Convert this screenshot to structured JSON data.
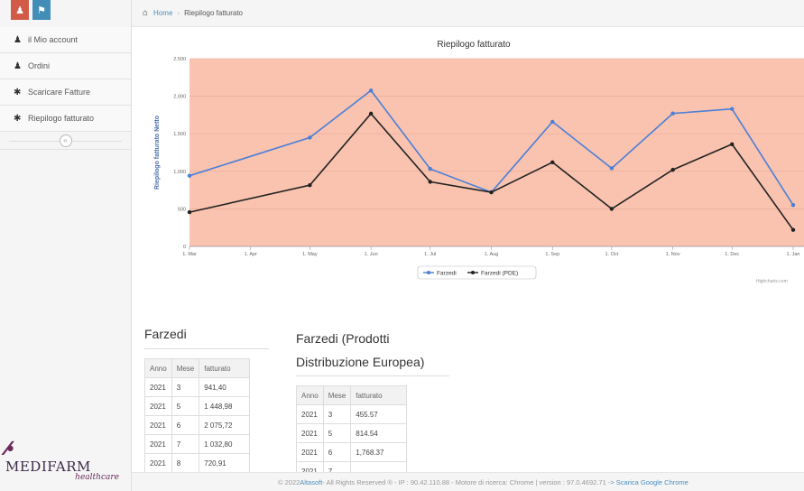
{
  "sidebar": {
    "items": [
      {
        "icon": "user-icon",
        "label": "il Mio account"
      },
      {
        "icon": "user-icon",
        "label": "Ordini"
      },
      {
        "icon": "gear-icon",
        "label": "Scaricare Fatture"
      },
      {
        "icon": "gear-icon",
        "label": "Riepilogo fatturato"
      }
    ],
    "logo": {
      "name": "MEDIFARM",
      "sub": "healthcare"
    }
  },
  "breadcrumb": {
    "home": "Home",
    "current": "Riepilogo fatturato"
  },
  "chart_data": {
    "type": "line",
    "title": "Riepilogo fatturato",
    "ylabel": "Riepilogo fatturato Netto",
    "xlabel": "",
    "ylim": [
      0,
      2500
    ],
    "yticks": [
      "0",
      "500",
      "1,000",
      "1,500",
      "2,000",
      "2,500"
    ],
    "xticks": [
      "1. Mar",
      "1. Apr",
      "1. May",
      "1. Jun",
      "1. Jul",
      "1. Aug",
      "1. Sep",
      "1. Oct",
      "1. Nov",
      "1. Dec",
      "1. Jan"
    ],
    "x": [
      "2021-03-01",
      "2021-05-01",
      "2021-06-01",
      "2021-07-01",
      "2021-08-01",
      "2021-09-01",
      "2021-10-01",
      "2021-11-01",
      "2021-12-01",
      "2022-01-01"
    ],
    "series": [
      {
        "name": "Farzedi",
        "color": "#4a7fd6",
        "values": [
          941.4,
          1448.98,
          2075.72,
          1032.8,
          720.91,
          1660,
          1040,
          1770,
          1830,
          550
        ]
      },
      {
        "name": "Farzedi (PDE)",
        "color": "#222222",
        "values": [
          455.57,
          814.54,
          1768.37,
          860,
          720,
          1120,
          500,
          1020,
          1360,
          220
        ]
      }
    ],
    "plot_background": "#f9c3b0",
    "legend": "bottom-center",
    "credit": "Highcharts.com"
  },
  "table1": {
    "title": "Farzedi",
    "headers": [
      "Anno",
      "Mese",
      "fatturato"
    ],
    "rows": [
      [
        "2021",
        "3",
        "941,40"
      ],
      [
        "2021",
        "5",
        "1 448,98"
      ],
      [
        "2021",
        "6",
        "2 075,72"
      ],
      [
        "2021",
        "7",
        "1 032,80"
      ],
      [
        "2021",
        "8",
        "720,91"
      ]
    ]
  },
  "table2": {
    "title": "Farzedi (Prodotti Distribuzione Europea)",
    "headers": [
      "Anno",
      "Mese",
      "fatturato"
    ],
    "rows": [
      [
        "2021",
        "3",
        "455.57"
      ],
      [
        "2021",
        "5",
        "814.54"
      ],
      [
        "2021",
        "6",
        "1,768.37"
      ],
      [
        "2021",
        "7",
        ""
      ]
    ]
  },
  "footer": {
    "text": "© 2022 ",
    "company": "Altasoft",
    "rest": " - All Rights Reserved ® - IP : 90.42.110.88 - Motore di ricerca: Chrome | version : 97.0.4692.71 - ",
    "link": "> Scarica Google Chrome"
  }
}
